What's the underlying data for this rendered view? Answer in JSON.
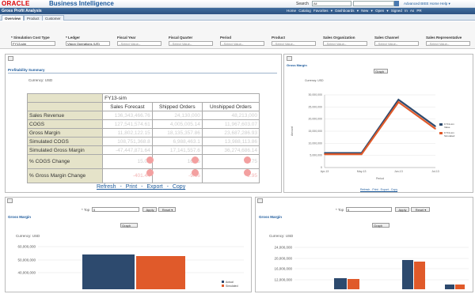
{
  "header": {
    "oracle_logo": "ORACLE",
    "app_title": "Business Intelligence",
    "search_label": "Search",
    "search_scope": "All",
    "top_links": "Advanced   BIEE Home   Help ▾",
    "nav_links": "Home  Catalog  Favorites ▾  Dashboards ▾  New ▾  Open ▾  Signed In As PR"
  },
  "dashboard": {
    "title": "Gross Profit Analysis"
  },
  "tabs": [
    "Overview",
    "Product",
    "Customer"
  ],
  "prompts": [
    {
      "label": "* Simulation Cost Type",
      "value": "FY13-sim",
      "placeholder": false
    },
    {
      "label": "* Ledger",
      "value": "Vision Operations (US)",
      "placeholder": false
    },
    {
      "label": "Fiscal Year",
      "value": "--Select Value--",
      "placeholder": true
    },
    {
      "label": "Fiscal Quarter",
      "value": "--Select Value--",
      "placeholder": true
    },
    {
      "label": "Period",
      "value": "--Select Value--",
      "placeholder": true
    },
    {
      "label": "Product",
      "value": "--Select Value--",
      "placeholder": true
    },
    {
      "label": "Sales Organization",
      "value": "--Select Value--",
      "placeholder": true
    },
    {
      "label": "Sales Channel",
      "value": "--Select Value--",
      "placeholder": true
    },
    {
      "label": "Sales Representative",
      "value": "--Select Value--",
      "placeholder": true
    }
  ],
  "summary": {
    "title": "Profitability Summary",
    "currency": "Currency:  USD",
    "scenario": "FY13-sim",
    "columns": [
      "Sales Forecast",
      "Shipped Orders",
      "Unshipped Orders"
    ],
    "rows": [
      {
        "label": "Sales Revenue",
        "values": [
          "136,343,466.76",
          "24,130,000",
          "48,213,000"
        ]
      },
      {
        "label": "COGS",
        "values": [
          "127,541,574.61",
          "4,005,005.14",
          "11,967,603.07"
        ]
      },
      {
        "label": "Gross Margin",
        "values": [
          "11,802,122.15",
          "18,135,357.86",
          "23,687,286.93"
        ]
      },
      {
        "label": "Simulated COGS",
        "values": [
          "108,751,368.8",
          "6,988,463.1",
          "13,988,113.86"
        ]
      },
      {
        "label": "Simulated Gross Margin",
        "values": [
          "-47,447,871.64",
          "17,141,557.6",
          "36,274,686.14"
        ]
      },
      {
        "label": "% COGS Change",
        "values": [
          "15.02",
          "16.46",
          "24.75"
        ]
      },
      {
        "label": "% Gross Margin Change",
        "values": [
          "-401.44",
          "-9.66",
          "-2.95"
        ]
      }
    ],
    "actions": [
      "Refresh",
      "Print",
      "Export",
      "Copy"
    ]
  },
  "gross_margin_line": {
    "title": "Gross Margin",
    "currency": "Currency:  USD",
    "view": "Graph",
    "links": "Refresh - Print - Export - Copy",
    "chart_data": {
      "type": "line",
      "categories": [
        "Apr-13",
        "May-13",
        "Jun-13",
        "Jul-13"
      ],
      "ylabel": "Amount",
      "xlabel": "Period",
      "ylim": [
        0,
        30000000
      ],
      "yticks": [
        "0",
        "5,000,000",
        "10,000,000",
        "15,000,000",
        "20,000,000",
        "25,000,000",
        "30,000,000"
      ],
      "series": [
        {
          "name": "FY13-sim Value",
          "color": "#2d4a6e",
          "values": [
            6000000,
            6000000,
            28000000,
            17000000
          ]
        },
        {
          "name": "FY13-sim Simulated",
          "color": "#e05a2a",
          "values": [
            5500000,
            5500000,
            27000000,
            16000000
          ]
        }
      ]
    }
  },
  "bottom_left": {
    "title": "Gross Margin",
    "top_label": "* Top",
    "top_value": "5",
    "apply": "Apply",
    "reset": "Reset ▾",
    "currency": "Currency:  USD",
    "view": "Graph",
    "chart_data": {
      "type": "bar",
      "yticks": [
        "40,000,000",
        "50,000,000",
        "60,000,000"
      ],
      "series": [
        {
          "name": "Actual",
          "color": "#2d4a6e"
        },
        {
          "name": "Simulated",
          "color": "#e05a2a"
        }
      ]
    }
  },
  "bottom_right": {
    "title": "Gross Margin",
    "top_label": "* Top",
    "top_value": "5",
    "apply": "Apply",
    "reset": "Reset ▾",
    "currency": "Currency:  USD",
    "view": "Graph",
    "chart_data": {
      "type": "bar",
      "yticks": [
        "12,000,000",
        "16,000,000",
        "20,000,000",
        "24,000,000"
      ],
      "series": [
        {
          "name": "Actual",
          "color": "#2d4a6e"
        },
        {
          "name": "Simulated",
          "color": "#e05a2a"
        }
      ]
    }
  }
}
